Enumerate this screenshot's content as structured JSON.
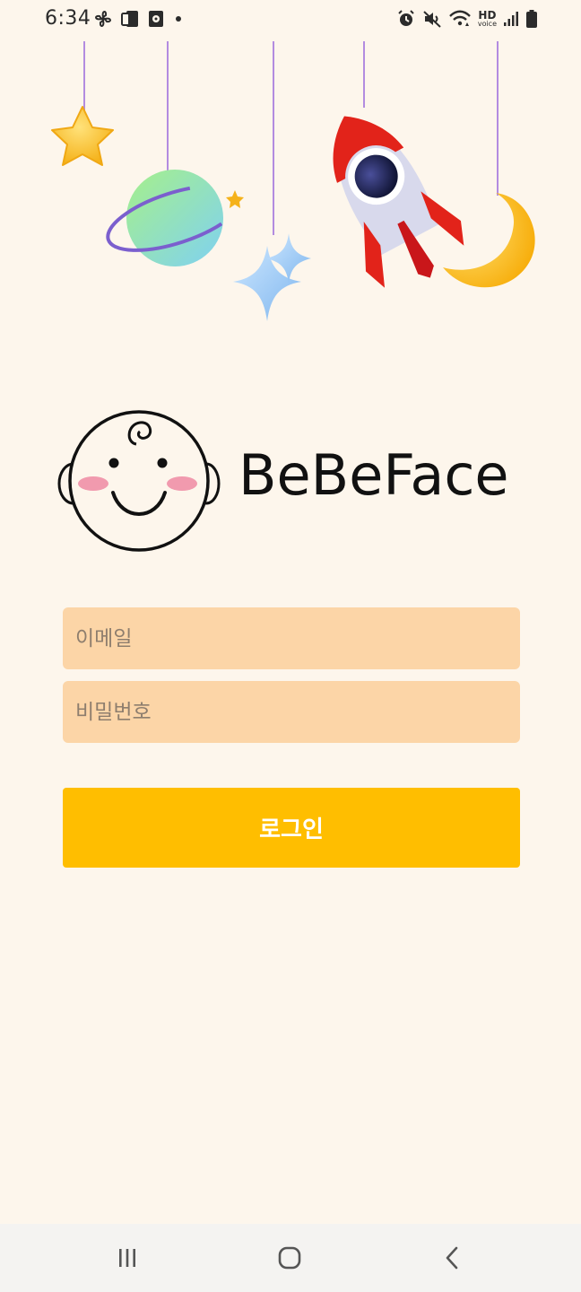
{
  "status_bar": {
    "time": "6:34",
    "left_icons": [
      "fan-icon",
      "device-icon",
      "media-icon",
      "dot-icon"
    ],
    "right_icons": [
      "alarm-icon",
      "mute-icon",
      "wifi-icon",
      "hd-voice-icon",
      "signal-icon",
      "battery-icon"
    ],
    "hd_label": "HD",
    "voice_label": "voice"
  },
  "logo": {
    "text": "BeBeFace"
  },
  "form": {
    "email_placeholder": "이메일",
    "password_placeholder": "비밀번호",
    "login_label": "로그인"
  },
  "nav_bar": {
    "items": [
      "recents-icon",
      "home-icon",
      "back-icon"
    ]
  },
  "colors": {
    "background": "#fdf6ec",
    "field": "#fcd5a7",
    "button": "#ffbe00",
    "button_text": "#ffffff"
  }
}
